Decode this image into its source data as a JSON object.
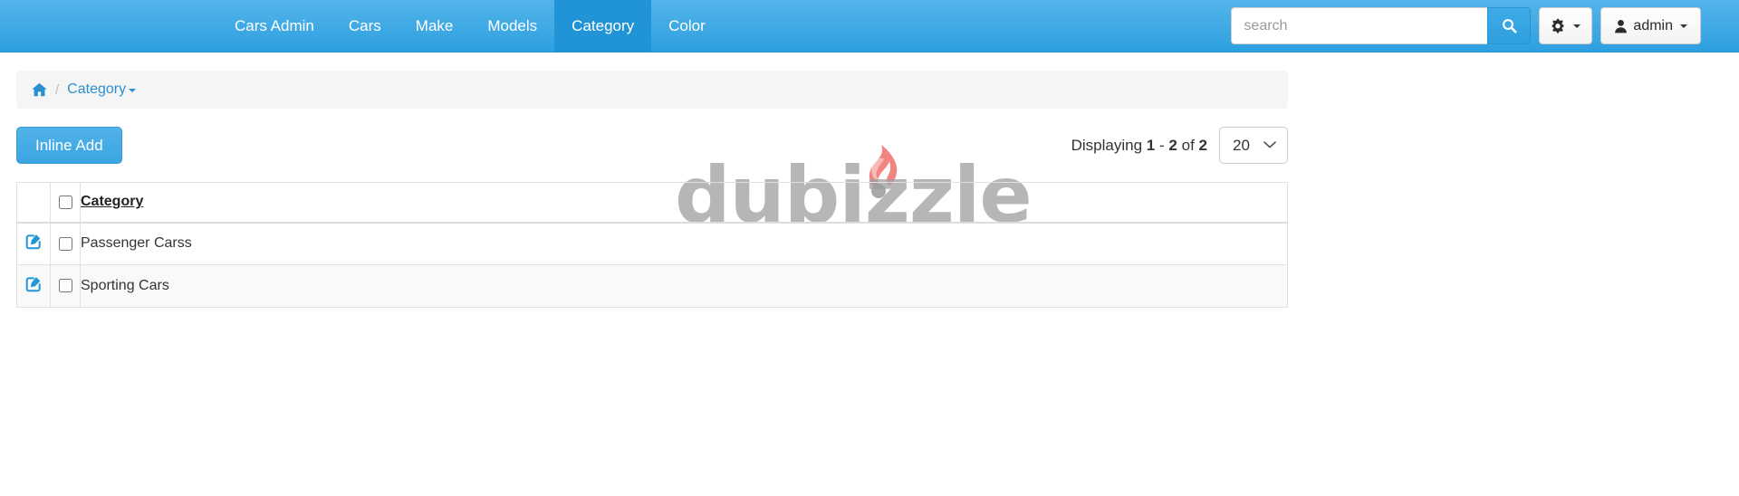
{
  "navbar": {
    "brand_color": "#3fa9e4",
    "active_color": "#2194d7",
    "items": [
      {
        "label": "Cars Admin",
        "active": false
      },
      {
        "label": "Cars",
        "active": false
      },
      {
        "label": "Make",
        "active": false
      },
      {
        "label": "Models",
        "active": false
      },
      {
        "label": "Category",
        "active": true
      },
      {
        "label": "Color",
        "active": false
      }
    ],
    "search": {
      "value": "",
      "placeholder": "search",
      "button_icon": "search-icon"
    },
    "settings": {
      "icon": "gear-icon",
      "caret": "caret-down-icon"
    },
    "user": {
      "icon": "user-icon",
      "label": "admin",
      "caret": "caret-down-icon"
    }
  },
  "breadcrumb": {
    "home_icon": "home-icon",
    "separator": "/",
    "current": "Category",
    "caret": "caret-down-icon",
    "link_color": "#2a8fce"
  },
  "toolbar": {
    "inline_add_label": "Inline Add",
    "displaying_prefix": "Displaying",
    "from": "1",
    "dash": "-",
    "to": "2",
    "of_word": "of",
    "total": "2",
    "page_size_value": "20",
    "page_size_options": [
      "20"
    ]
  },
  "table": {
    "columns": [
      {
        "key": "action",
        "label": ""
      },
      {
        "key": "select",
        "label": ""
      },
      {
        "key": "category",
        "label": "Category",
        "sortable": true
      }
    ],
    "select_all_checked": false,
    "rows": [
      {
        "edit_icon": "edit-square-icon",
        "checked": false,
        "category": "Passenger Carss"
      },
      {
        "edit_icon": "edit-square-icon",
        "checked": false,
        "category": "Sporting Cars"
      }
    ]
  },
  "watermark": {
    "text": "dubizzle",
    "flame_icon": "flame-icon",
    "text_color": "#9e9e9e",
    "flame_color": "#f2857f"
  }
}
